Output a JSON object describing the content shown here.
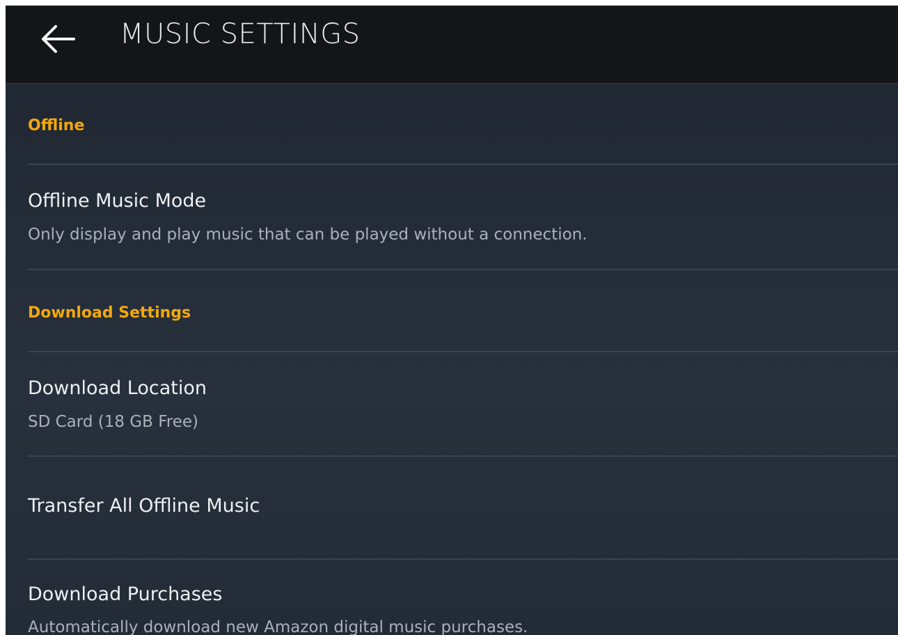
{
  "header": {
    "title": "MUSIC SETTINGS",
    "back_icon": "back-arrow-icon"
  },
  "sections": {
    "offline": {
      "label": "Offline",
      "items": [
        {
          "title": "Offline Music Mode",
          "subtitle": "Only display and play music that can be played without a connection."
        }
      ]
    },
    "download": {
      "label": "Download Settings",
      "items": [
        {
          "title": "Download Location",
          "subtitle": "SD Card (18 GB Free)"
        },
        {
          "title": "Transfer All Offline Music"
        },
        {
          "title": "Download Purchases",
          "subtitle": "Automatically download new Amazon digital music purchases."
        }
      ]
    }
  },
  "colors": {
    "accent": "#f3a80d",
    "appbar": "#131518",
    "background": "#232b36",
    "primary_text": "#eef0f3",
    "secondary_text": "#aab1ba"
  }
}
